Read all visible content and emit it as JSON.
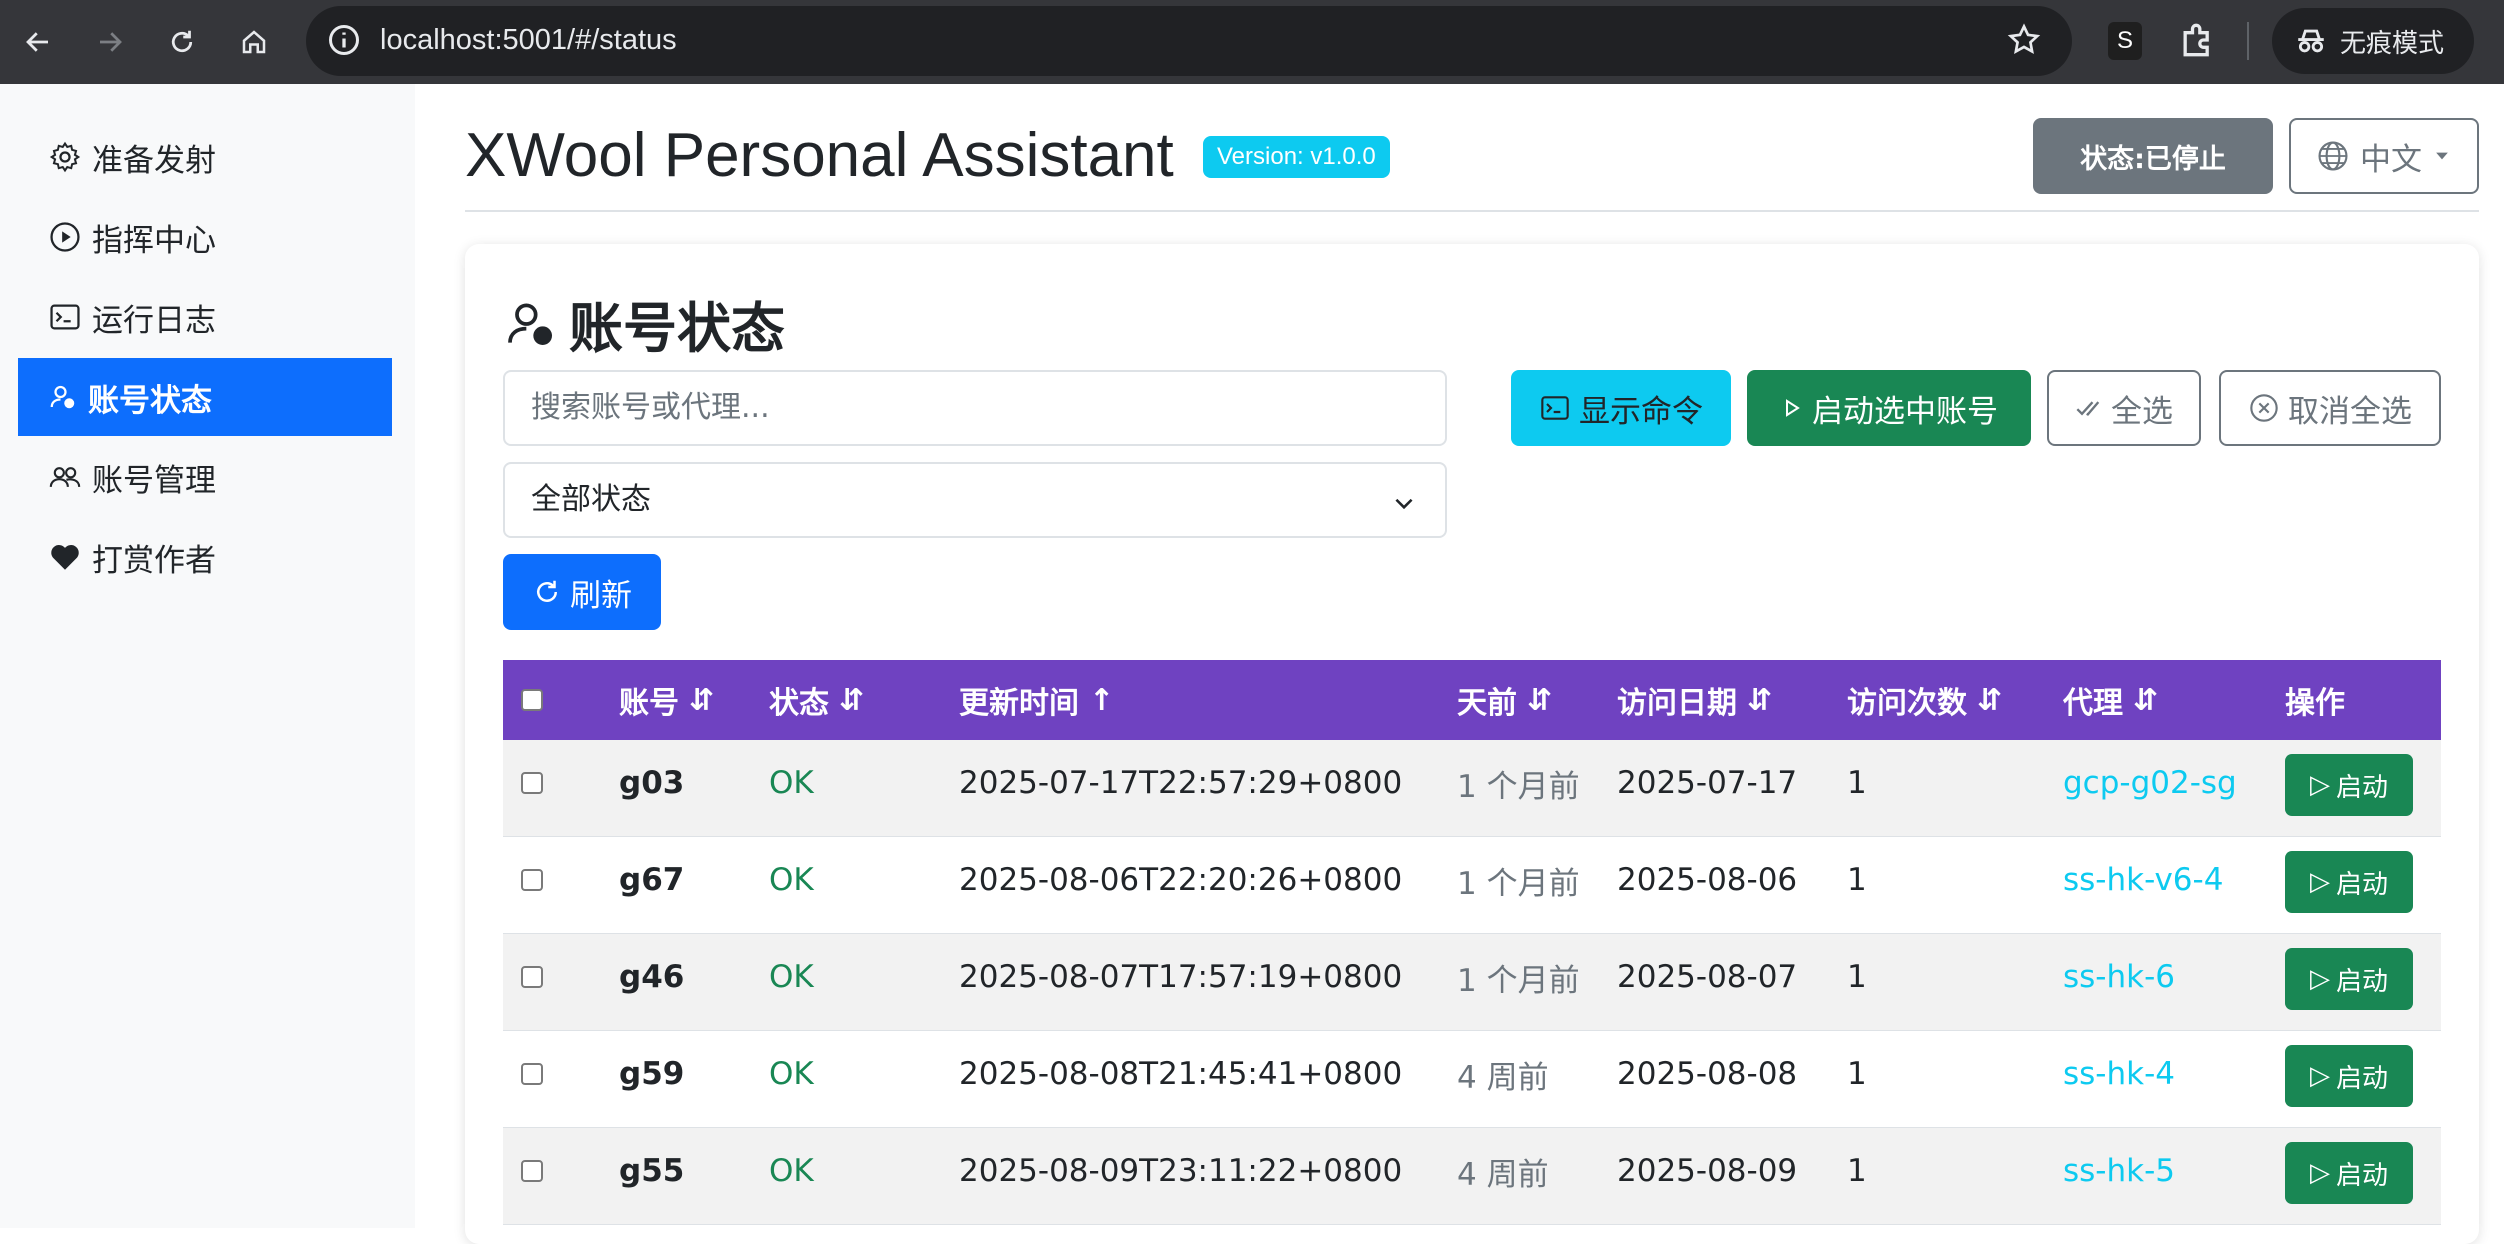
{
  "browser": {
    "url": "localhost:5001/#/status",
    "extension_label": "S",
    "incognito_label": "无痕模式"
  },
  "sidebar": {
    "items": [
      {
        "label": "准备发射",
        "icon": "gear-icon"
      },
      {
        "label": "指挥中心",
        "icon": "play-circle-icon"
      },
      {
        "label": "运行日志",
        "icon": "terminal-icon"
      },
      {
        "label": "账号状态",
        "icon": "person-badge-icon",
        "active": true
      },
      {
        "label": "账号管理",
        "icon": "people-icon"
      },
      {
        "label": "打赏作者",
        "icon": "heart-icon"
      }
    ]
  },
  "header": {
    "title": "XWool Personal Assistant",
    "version": "Version: v1.0.0",
    "status_label": "状态:已停止",
    "language": "中文"
  },
  "card": {
    "title": "账号状态",
    "search_placeholder": "搜索账号或代理...",
    "filter_value": "全部状态",
    "refresh_label": "刷新",
    "show_cmd_label": "显示命令",
    "start_selected_label": "启动选中账号",
    "select_all_label": "全选",
    "deselect_all_label": "取消全选"
  },
  "table": {
    "headers": {
      "account": "账号",
      "status": "状态",
      "updated": "更新时间",
      "ago": "天前",
      "visit_date": "访问日期",
      "visit_count": "访问次数",
      "proxy": "代理",
      "action": "操作"
    },
    "rows": [
      {
        "account": "g03",
        "status": "OK",
        "updated": "2025-07-17T22:57:29+0800",
        "ago": "1 个月前",
        "visit_date": "2025-07-17",
        "visit_count": "1",
        "proxy": "gcp-g02-sg",
        "action": "启动"
      },
      {
        "account": "g67",
        "status": "OK",
        "updated": "2025-08-06T22:20:26+0800",
        "ago": "1 个月前",
        "visit_date": "2025-08-06",
        "visit_count": "1",
        "proxy": "ss-hk-v6-4",
        "action": "启动"
      },
      {
        "account": "g46",
        "status": "OK",
        "updated": "2025-08-07T17:57:19+0800",
        "ago": "1 个月前",
        "visit_date": "2025-08-07",
        "visit_count": "1",
        "proxy": "ss-hk-6",
        "action": "启动"
      },
      {
        "account": "g59",
        "status": "OK",
        "updated": "2025-08-08T21:45:41+0800",
        "ago": "4 周前",
        "visit_date": "2025-08-08",
        "visit_count": "1",
        "proxy": "ss-hk-4",
        "action": "启动"
      },
      {
        "account": "g55",
        "status": "OK",
        "updated": "2025-08-09T23:11:22+0800",
        "ago": "4 周前",
        "visit_date": "2025-08-09",
        "visit_count": "1",
        "proxy": "ss-hk-5",
        "action": "启动"
      }
    ]
  },
  "colors": {
    "primary": "#0d6efd",
    "table_header": "#6f42c1",
    "success": "#198754",
    "info": "#0dcaf0",
    "secondary": "#6c757d"
  }
}
